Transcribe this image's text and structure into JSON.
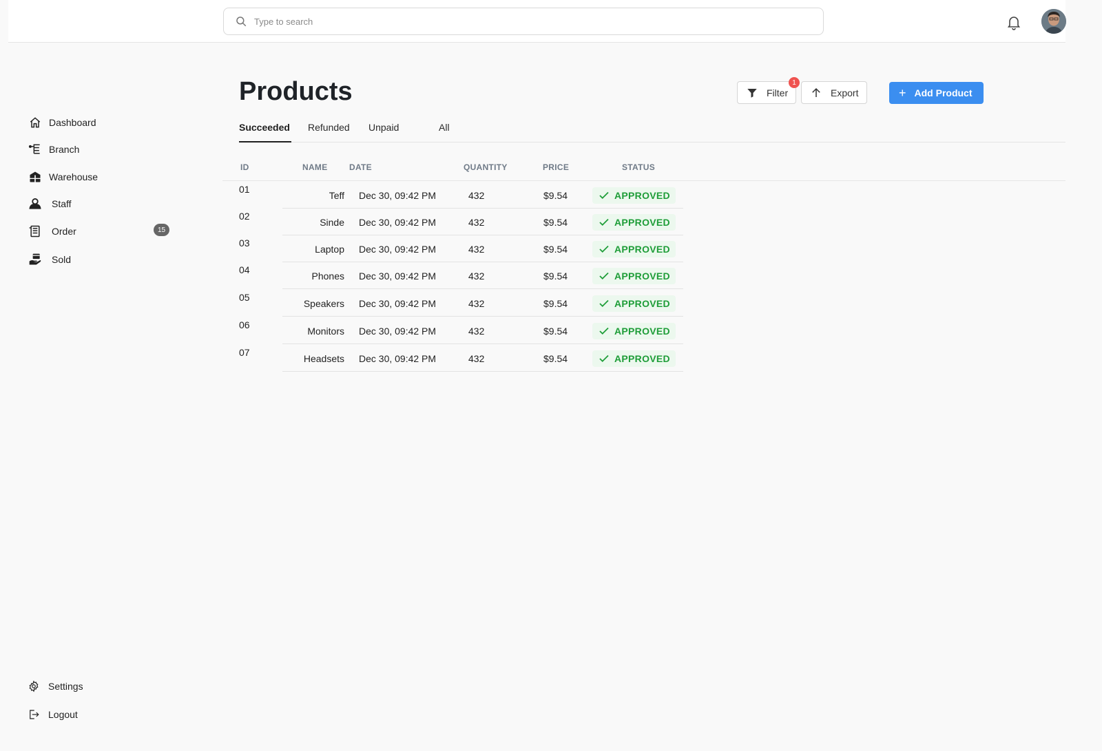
{
  "search": {
    "placeholder": "Type to search"
  },
  "sidebar": {
    "items": [
      {
        "label": "Dashboard",
        "icon": "home-icon"
      },
      {
        "label": "Branch",
        "icon": "branch-icon"
      },
      {
        "label": "Warehouse",
        "icon": "warehouse-icon"
      },
      {
        "label": "Staff",
        "icon": "staff-icon"
      },
      {
        "label": "Order",
        "icon": "order-icon",
        "badge": "15"
      },
      {
        "label": "Sold",
        "icon": "sold-icon"
      }
    ],
    "bottom": [
      {
        "label": "Settings",
        "icon": "gear-icon"
      },
      {
        "label": "Logout",
        "icon": "logout-icon"
      }
    ]
  },
  "page": {
    "title": "Products",
    "filter_label": "Filter",
    "filter_count": "1",
    "export_label": "Export",
    "add_label": "Add Product"
  },
  "tabs": [
    "Succeeded",
    "Refunded",
    "Unpaid",
    "All"
  ],
  "table": {
    "headers": [
      "ID",
      "NAME",
      "DATE",
      "QUANTITY",
      "PRICE",
      "STATUS"
    ],
    "rows": [
      {
        "id": "01",
        "name": "Teff",
        "date": "Dec 30, 09:42 PM",
        "qty": "432",
        "price": "$9.54",
        "status": "APPROVED"
      },
      {
        "id": "02",
        "name": "Sinde",
        "date": "Dec 30, 09:42 PM",
        "qty": "432",
        "price": "$9.54",
        "status": "APPROVED"
      },
      {
        "id": "03",
        "name": "Laptop",
        "date": "Dec 30, 09:42 PM",
        "qty": "432",
        "price": "$9.54",
        "status": "APPROVED"
      },
      {
        "id": "04",
        "name": "Phones",
        "date": "Dec 30, 09:42 PM",
        "qty": "432",
        "price": "$9.54",
        "status": "APPROVED"
      },
      {
        "id": "05",
        "name": "Speakers",
        "date": "Dec 30, 09:42 PM",
        "qty": "432",
        "price": "$9.54",
        "status": "APPROVED"
      },
      {
        "id": "06",
        "name": "Monitors",
        "date": "Dec 30, 09:42 PM",
        "qty": "432",
        "price": "$9.54",
        "status": "APPROVED"
      },
      {
        "id": "07",
        "name": "Headsets",
        "date": "Dec 30, 09:42 PM",
        "qty": "432",
        "price": "$9.54",
        "status": "APPROVED"
      }
    ]
  },
  "colors": {
    "accent": "#3b8ef0",
    "approved": "#1e9d38",
    "approved_bg": "#ecf8ee",
    "alert": "#ef5350"
  }
}
